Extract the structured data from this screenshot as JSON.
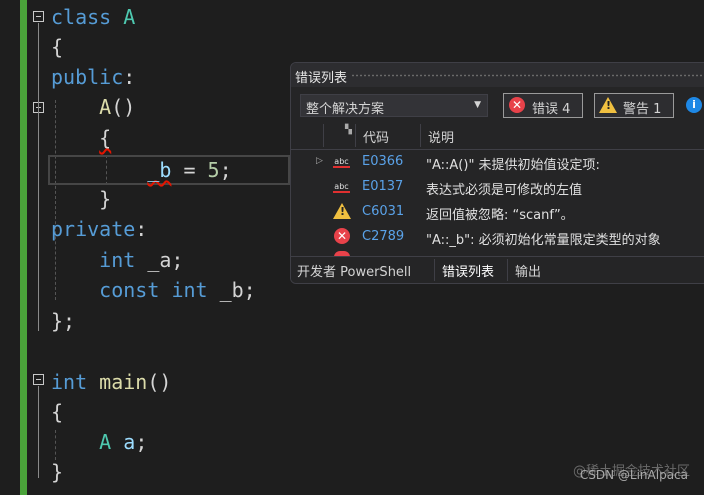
{
  "code_lines": [
    {
      "parts": [
        [
          "kw",
          "class"
        ],
        [
          "sp",
          " "
        ],
        [
          "ty",
          "A"
        ]
      ]
    },
    {
      "parts": [
        [
          "pl",
          "{"
        ]
      ]
    },
    {
      "parts": [
        [
          "kw",
          "public"
        ],
        [
          "pl",
          ":"
        ]
      ]
    },
    {
      "parts": [
        [
          "pl",
          "    "
        ],
        [
          "fn",
          "A"
        ],
        [
          "pl",
          "()"
        ]
      ]
    },
    {
      "parts": [
        [
          "pl",
          "    "
        ],
        [
          "pl",
          "{"
        ]
      ]
    },
    {
      "parts": [
        [
          "pl",
          "        "
        ],
        [
          "vr",
          "_b"
        ],
        [
          "pl",
          " = "
        ],
        [
          "nm",
          "5"
        ],
        [
          "pl",
          ";"
        ]
      ]
    },
    {
      "parts": [
        [
          "pl",
          "    }"
        ]
      ]
    },
    {
      "parts": [
        [
          "kw",
          "private"
        ],
        [
          "pl",
          ":"
        ]
      ]
    },
    {
      "parts": [
        [
          "pl",
          "    "
        ],
        [
          "kw",
          "int"
        ],
        [
          "pl",
          " _a;"
        ]
      ]
    },
    {
      "parts": [
        [
          "pl",
          "    "
        ],
        [
          "kw",
          "const"
        ],
        [
          "pl",
          " "
        ],
        [
          "kw",
          "int"
        ],
        [
          "pl",
          " _b;"
        ]
      ]
    },
    {
      "parts": [
        [
          "pl",
          "};"
        ]
      ]
    },
    {
      "parts": [
        [
          "pl",
          ""
        ]
      ]
    },
    {
      "parts": [
        [
          "kw",
          "int"
        ],
        [
          "pl",
          " "
        ],
        [
          "fn",
          "main"
        ],
        [
          "pl",
          "()"
        ]
      ]
    },
    {
      "parts": [
        [
          "pl",
          "{"
        ]
      ]
    },
    {
      "parts": [
        [
          "pl",
          "    "
        ],
        [
          "ty",
          "A"
        ],
        [
          "pl",
          " "
        ],
        [
          "vr",
          "a"
        ],
        [
          "pl",
          ";"
        ]
      ]
    },
    {
      "parts": [
        [
          "pl",
          "}"
        ]
      ]
    }
  ],
  "error_list": {
    "title": "错误列表",
    "scope": "整个解决方案",
    "errors_label": "错误 4",
    "warnings_label": "警告 1",
    "col_code": "代码",
    "col_desc": "说明",
    "rows": [
      {
        "icon": "abc-error-icon",
        "code": "E0366",
        "desc": "\"A::A()\" 未提供初始值设定项:"
      },
      {
        "icon": "abc-error-icon",
        "code": "E0137",
        "desc": "表达式必须是可修改的左值"
      },
      {
        "icon": "warning-icon",
        "code": "C6031",
        "desc": "返回值被忽略: “scanf”。"
      },
      {
        "icon": "error-icon",
        "code": "C2789",
        "desc": "\"A::_b\": 必须初始化常量限定类型的对象"
      }
    ],
    "tabs": [
      "开发者 PowerShell",
      "错误列表",
      "输出"
    ]
  },
  "watermark": {
    "site": "@稀土掘金技术社区",
    "author": "CSDN @LinAlpaca"
  },
  "colors": {
    "gutter": "#4aa33a",
    "keyword": "#569cd6",
    "type": "#4ec9b0",
    "function": "#dcdcaa",
    "error": "#e8424a",
    "warning": "#f0c040"
  }
}
